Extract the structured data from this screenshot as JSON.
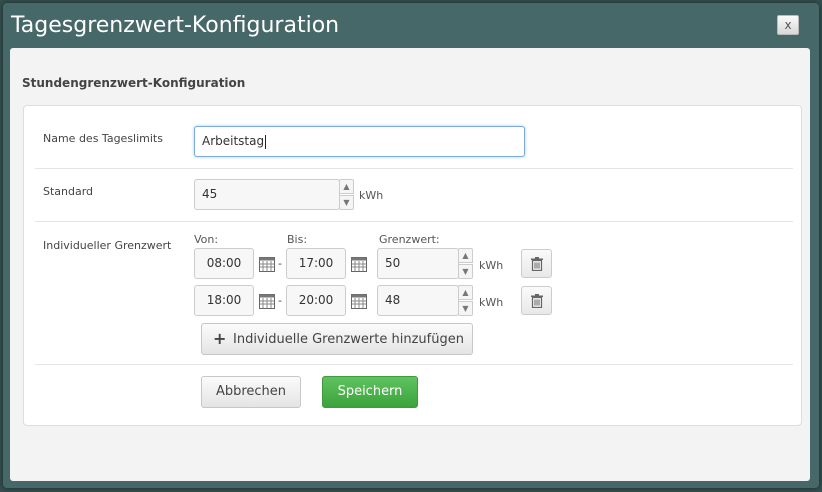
{
  "dialog": {
    "title": "Tagesgrenzwert-Konfiguration",
    "close_label": "x"
  },
  "section": {
    "title": "Stundengrenzwert-Konfiguration"
  },
  "form": {
    "name_label": "Name des Tageslimits",
    "name_value": "Arbeitstag",
    "standard_label": "Standard",
    "standard_value": "45",
    "standard_unit": "kWh",
    "individual_label": "Individueller Grenzwert",
    "col_from": "Von:",
    "col_to": "Bis:",
    "col_limit": "Grenzwert:",
    "rows": [
      {
        "from": "08:00",
        "to": "17:00",
        "limit": "50",
        "unit": "kWh"
      },
      {
        "from": "18:00",
        "to": "20:00",
        "limit": "48",
        "unit": "kWh"
      }
    ],
    "add_label": "Individuelle Grenzwerte hinzufügen",
    "cancel_label": "Abbrechen",
    "save_label": "Speichern",
    "range_separator": "-"
  },
  "icons": {
    "calendar": "calendar-icon",
    "trash": "trash-icon",
    "plus": "plus-icon",
    "spin_up": "caret-up-icon",
    "spin_down": "caret-down-icon",
    "close": "close-icon"
  },
  "colors": {
    "modal_header": "#466868",
    "save_button": "#4cb34c",
    "focus_border": "#7aaad8"
  }
}
